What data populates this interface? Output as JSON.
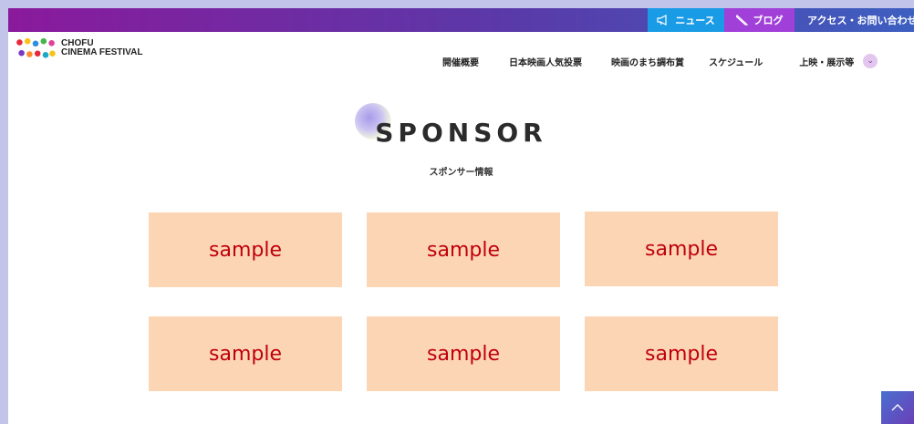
{
  "top_nav": {
    "news": "ニュース",
    "blog": "ブログ",
    "access": "アクセス・お問い合わせ"
  },
  "logo": {
    "line1": "CHOFU",
    "line2": "CINEMA FESTIVAL"
  },
  "main_nav": [
    "開催概要",
    "日本映画人気投票",
    "映画のまち調布賞",
    "スケジュール",
    "上映・展示等"
  ],
  "section": {
    "title": "SPONSOR",
    "subtitle": "スポンサー情報"
  },
  "sponsors": [
    "sample",
    "sample",
    "sample",
    "sample",
    "sample",
    "sample"
  ],
  "icons": {
    "news": "megaphone-icon",
    "blog": "pencil-icon",
    "access": "location-pin-icon",
    "more": "chevron-down-icon",
    "back_to_top": "chevron-up-icon"
  },
  "colors": {
    "strip_start": "#8a1a9c",
    "strip_end": "#3d5fc0",
    "news_bg": "#1a9be6",
    "blog_bg": "#a040d8",
    "tile_bg": "#fcd5b5",
    "tile_text": "#c0000c"
  }
}
